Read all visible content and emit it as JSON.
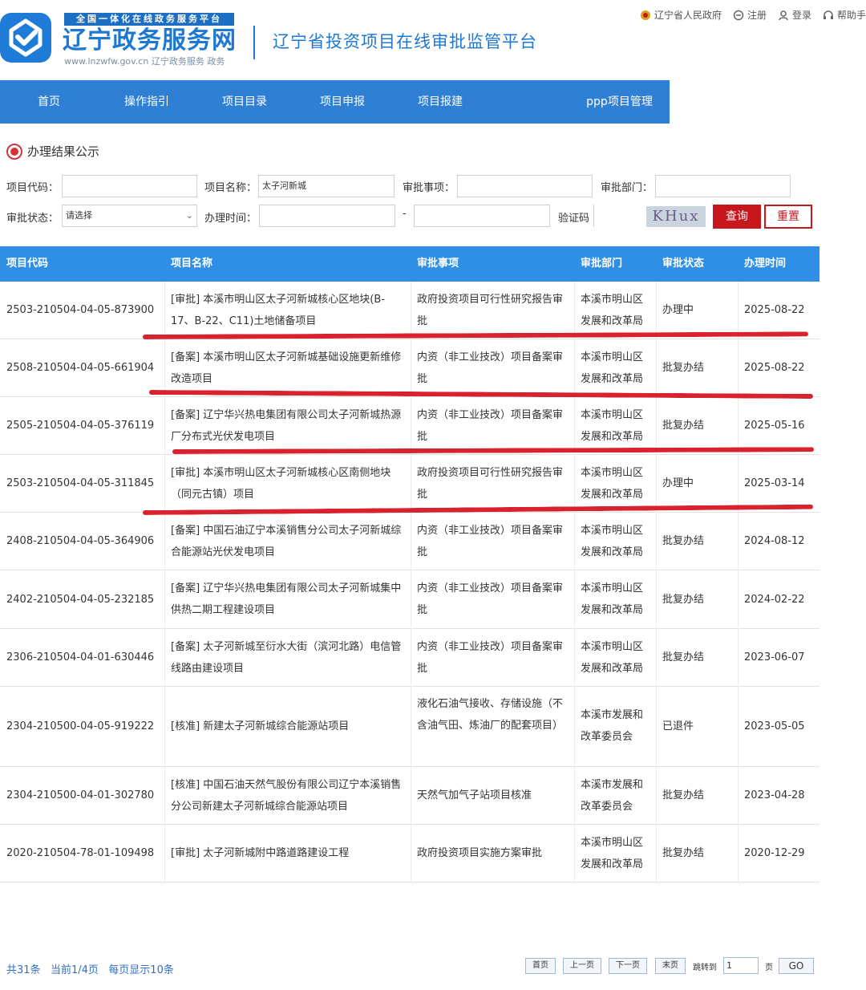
{
  "header": {
    "logo_top": "全国一体化在线政务服务平台",
    "logo_title": "辽宁政务服务网",
    "logo_url": "www.lnzwfw.gov.cn  辽宁政务服务 政务",
    "platform_title": "辽宁省投资项目在线审批监管平台",
    "links": {
      "gov": "辽宁省人民政府",
      "register": "注册",
      "login": "登录",
      "help": "帮助手"
    }
  },
  "nav": [
    "首页",
    "操作指引",
    "项目目录",
    "项目申报",
    "项目报建",
    "",
    "ppp项目管理"
  ],
  "section": {
    "title": "办理结果公示"
  },
  "filters": {
    "code_label": "项目代码：",
    "code_value": "",
    "name_label": "项目名称：",
    "name_value": "太子河新城",
    "item_label": "审批事项：",
    "item_value": "",
    "dept_label": "审批部门：",
    "dept_value": "",
    "status_label": "审批状态：",
    "status_value": "请选择",
    "time_label": "办理时间：",
    "time_from": "",
    "time_sep": "-",
    "time_to": "",
    "captcha_label": "验证码",
    "captcha_text": "KHux",
    "query_label": "查询",
    "reset_label": "重置"
  },
  "table": {
    "headers": [
      "项目代码",
      "项目名称",
      "审批事项",
      "审批部门",
      "审批状态",
      "办理时间"
    ],
    "rows": [
      {
        "code": "2503-210504-04-05-873900",
        "name": "[审批] 本溪市明山区太子河新城核心区地块(B-17、B-22、C11)土地储备项目",
        "item": "政府投资项目可行性研究报告审批",
        "dept": "本溪市明山区发展和改革局",
        "status": "办理中",
        "time": "2025-08-22"
      },
      {
        "code": "2508-210504-04-05-661904",
        "name": "[备案] 本溪市明山区太子河新城基础设施更新维修改造项目",
        "item": "内资（非工业技改）项目备案审批",
        "dept": "本溪市明山区发展和改革局",
        "status": "批复办结",
        "time": "2025-08-22"
      },
      {
        "code": "2505-210504-04-05-376119",
        "name": "[备案] 辽宁华兴热电集团有限公司太子河新城热源厂分布式光伏发电项目",
        "item": "内资（非工业技改）项目备案审批",
        "dept": "本溪市明山区发展和改革局",
        "status": "批复办结",
        "time": "2025-05-16"
      },
      {
        "code": "2503-210504-04-05-311845",
        "name": "[审批] 本溪市明山区太子河新城核心区南侧地块（同元古镇）项目",
        "item": "政府投资项目可行性研究报告审批",
        "dept": "本溪市明山区发展和改革局",
        "status": "办理中",
        "time": "2025-03-14"
      },
      {
        "code": "2408-210504-04-05-364906",
        "name": "[备案] 中国石油辽宁本溪销售分公司太子河新城综合能源站光伏发电项目",
        "item": "内资（非工业技改）项目备案审批",
        "dept": "本溪市明山区发展和改革局",
        "status": "批复办结",
        "time": "2024-08-12"
      },
      {
        "code": "2402-210504-04-05-232185",
        "name": "[备案] 辽宁华兴热电集团有限公司太子河新城集中供热二期工程建设项目",
        "item": "内资（非工业技改）项目备案审批",
        "dept": "本溪市明山区发展和改革局",
        "status": "批复办结",
        "time": "2024-02-22"
      },
      {
        "code": "2306-210504-04-01-630446",
        "name": "[备案] 太子河新城至衍水大街（滨河北路）电信管线路由建设项目",
        "item": "内资（非工业技改）项目备案审批",
        "dept": "本溪市明山区发展和改革局",
        "status": "批复办结",
        "time": "2023-06-07"
      },
      {
        "code": "2304-210500-04-05-919222",
        "name": "[核准] 新建太子河新城综合能源站项目",
        "item": "液化石油气接收、存储设施（不含油气田、炼油厂的配套项目）",
        "dept": "本溪市发展和改革委员会",
        "status": "已退件",
        "time": "2023-05-05"
      },
      {
        "code": "2304-210500-04-01-302780",
        "name": "[核准] 中国石油天然气股份有限公司辽宁本溪销售分公司新建太子河新城综合能源站项目",
        "item": "天然气加气子站项目核准",
        "dept": "本溪市发展和改革委员会",
        "status": "批复办结",
        "time": "2023-04-28"
      },
      {
        "code": "2020-210504-78-01-109498",
        "name": "[审批] 太子河新城附中路道路建设工程",
        "item": "政府投资项目实施方案审批",
        "dept": "本溪市明山区发展和改革局",
        "status": "批复办结",
        "time": "2020-12-29"
      }
    ]
  },
  "pager": {
    "total": "共31条",
    "current": "当前1/4页",
    "per_page": "每页显示10条",
    "first": "首页",
    "prev": "上一页",
    "next": "下一页",
    "last": "末页",
    "jump_label": "跳转到",
    "jump_value": "1",
    "page_unit": "页",
    "go": "GO"
  },
  "colors": {
    "nav_bg": "#2f7fd5",
    "table_header_bg": "#2f8fe6",
    "accent_red": "#c8161d",
    "annotation_red": "#d8222e"
  }
}
